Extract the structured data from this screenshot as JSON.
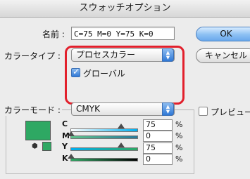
{
  "window": {
    "title": "スウォッチオプション"
  },
  "form": {
    "name_label": "名前 :",
    "name_value": "C=75 M=0 Y=75 K=0",
    "color_type_label": "カラータイプ :",
    "color_type_value": "プロセスカラー",
    "global_label": "グローバル",
    "global_checked": true,
    "color_mode_label": "カラーモード :",
    "color_mode_value": "CMYK"
  },
  "buttons": {
    "ok": "OK",
    "cancel": "キャンセル",
    "preview_label": "プレビュー"
  },
  "swatch_color": "#2ea863",
  "sliders": [
    {
      "channel": "C",
      "value": "75",
      "unit": "%"
    },
    {
      "channel": "M",
      "value": "0",
      "unit": "%"
    },
    {
      "channel": "Y",
      "value": "75",
      "unit": "%"
    },
    {
      "channel": "K",
      "value": "0",
      "unit": "%"
    }
  ],
  "icons": {
    "out_of_gamut": "cube-icon",
    "popup_arrows": "updown-arrows-icon",
    "checkmark": "checkmark-icon"
  },
  "colors": {
    "highlight": "#e2202c",
    "default_button": "#8cc0f3",
    "swatch": "#2ea863"
  }
}
